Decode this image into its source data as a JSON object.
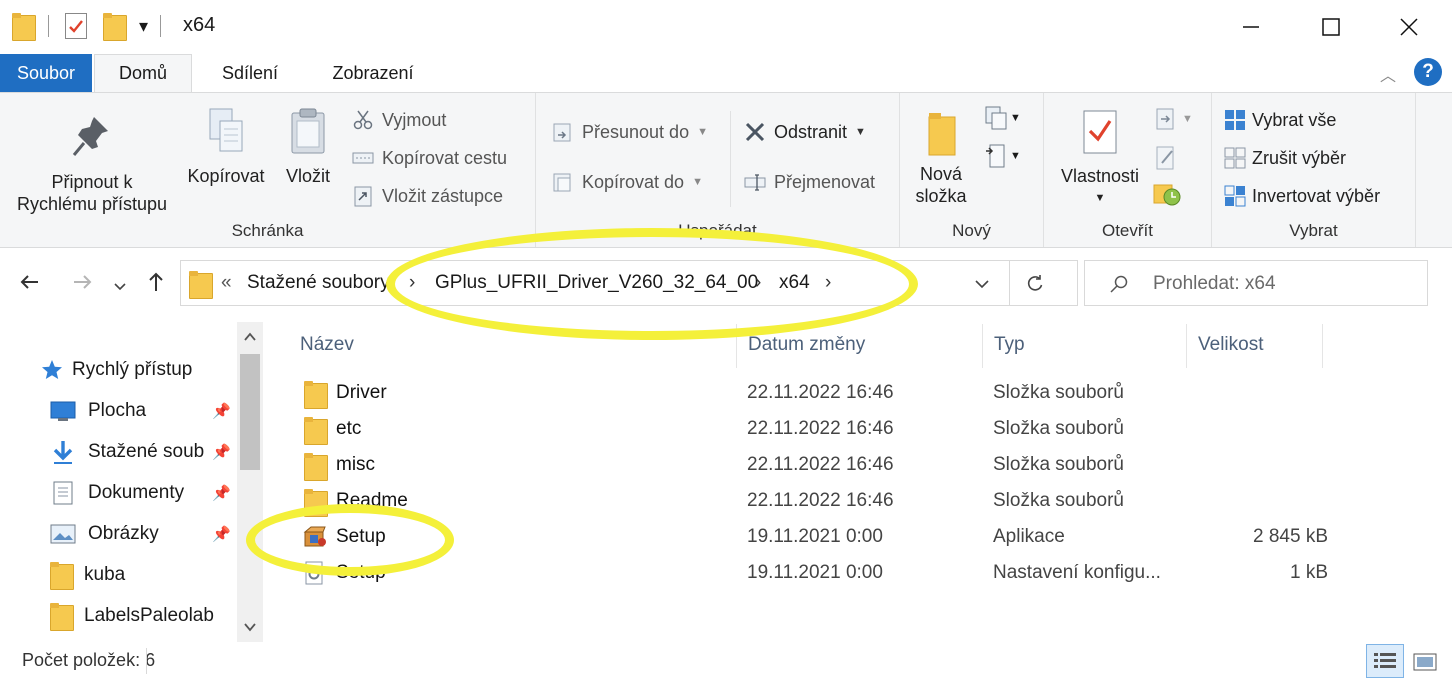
{
  "window": {
    "title": "x64",
    "minimize": "—",
    "maximize": "☐",
    "close": "✕",
    "qat_dropdown": "▾"
  },
  "tabs": {
    "file": "Soubor",
    "home": "Domů",
    "share": "Sdílení",
    "view": "Zobrazení"
  },
  "ribbon": {
    "clipboard": {
      "label": "Schránka",
      "pin_line1": "Připnout k",
      "pin_line2": "Rychlému přístupu",
      "copy": "Kopírovat",
      "paste": "Vložit",
      "cut": "Vyjmout",
      "copy_path": "Kopírovat cestu",
      "paste_shortcut": "Vložit zástupce"
    },
    "organize": {
      "label": "Uspořádat",
      "move_to": "Přesunout do",
      "copy_to": "Kopírovat do",
      "delete": "Odstranit",
      "rename": "Přejmenovat"
    },
    "new": {
      "label": "Nový",
      "new_folder_line1": "Nová",
      "new_folder_line2": "složka"
    },
    "open": {
      "label": "Otevřít",
      "properties": "Vlastnosti"
    },
    "select": {
      "label": "Vybrat",
      "select_all": "Vybrat vše",
      "select_none": "Zrušit výběr",
      "invert": "Invertovat výběr"
    }
  },
  "address": {
    "overflow": "«",
    "crumbs": [
      "Stažené soubory",
      "GPlus_UFRII_Driver_V260_32_64_00",
      "x64"
    ],
    "separator": "›",
    "search_placeholder": "Prohledat: x64"
  },
  "nav": {
    "quick_access": "Rychlý přístup",
    "items": [
      {
        "label": "Plocha",
        "pinned": true
      },
      {
        "label": "Stažené soub",
        "pinned": true
      },
      {
        "label": "Dokumenty",
        "pinned": true
      },
      {
        "label": "Obrázky",
        "pinned": true
      },
      {
        "label": "kuba",
        "pinned": false
      },
      {
        "label": "LabelsPaleolab",
        "pinned": false
      }
    ]
  },
  "columns": {
    "name": "Název",
    "date": "Datum změny",
    "type": "Typ",
    "size": "Velikost"
  },
  "files": [
    {
      "name": "Driver",
      "date": "22.11.2022 16:46",
      "type": "Složka souborů",
      "size": "",
      "icon": "folder-icon"
    },
    {
      "name": "etc",
      "date": "22.11.2022 16:46",
      "type": "Složka souborů",
      "size": "",
      "icon": "folder-icon"
    },
    {
      "name": "misc",
      "date": "22.11.2022 16:46",
      "type": "Složka souborů",
      "size": "",
      "icon": "folder-icon"
    },
    {
      "name": "Readme",
      "date": "22.11.2022 16:46",
      "type": "Složka souborů",
      "size": "",
      "icon": "folder-icon"
    },
    {
      "name": "Setup",
      "date": "19.11.2021 0:00",
      "type": "Aplikace",
      "size": "2 845 kB",
      "icon": "installer-icon"
    },
    {
      "name": "Setup",
      "date": "19.11.2021 0:00",
      "type": "Nastavení konfigu...",
      "size": "1 kB",
      "icon": "config-file-icon"
    }
  ],
  "status": {
    "item_count": "Počet položek: 6"
  },
  "colors": {
    "accent": "#1f6ec2",
    "highlight": "#f4f03a",
    "folder": "#f6c94f"
  }
}
